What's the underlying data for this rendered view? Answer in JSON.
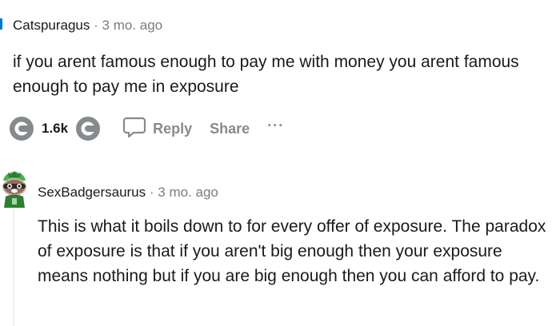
{
  "comment": {
    "author": "Catspuragus",
    "separator": "·",
    "timestamp": "3 mo. ago",
    "body": "if you arent famous enough to pay me with money you arent famous enough to pay me in exposure",
    "vote_count": "1.6k",
    "actions": {
      "reply_label": "Reply",
      "share_label": "Share",
      "more_label": "···"
    }
  },
  "reply": {
    "author": "SexBadgersaurus",
    "separator": "·",
    "timestamp": "3 mo. ago",
    "body": "This is what it boils down to for every offer of exposure. The paradox of exposure is that if you aren't big enough then your exposure means nothing but if you are big enough then you can afford to pay."
  },
  "colors": {
    "thread_accent": "#0079d3",
    "muted_text": "#7c7c7c",
    "action_text": "#878a8c",
    "vote_icon": "#878a8c"
  },
  "icons": {
    "upvote": "upvote-icon",
    "downvote": "downvote-icon",
    "reply": "speech-bubble-icon",
    "avatar": "snoo-avatar-icon"
  }
}
